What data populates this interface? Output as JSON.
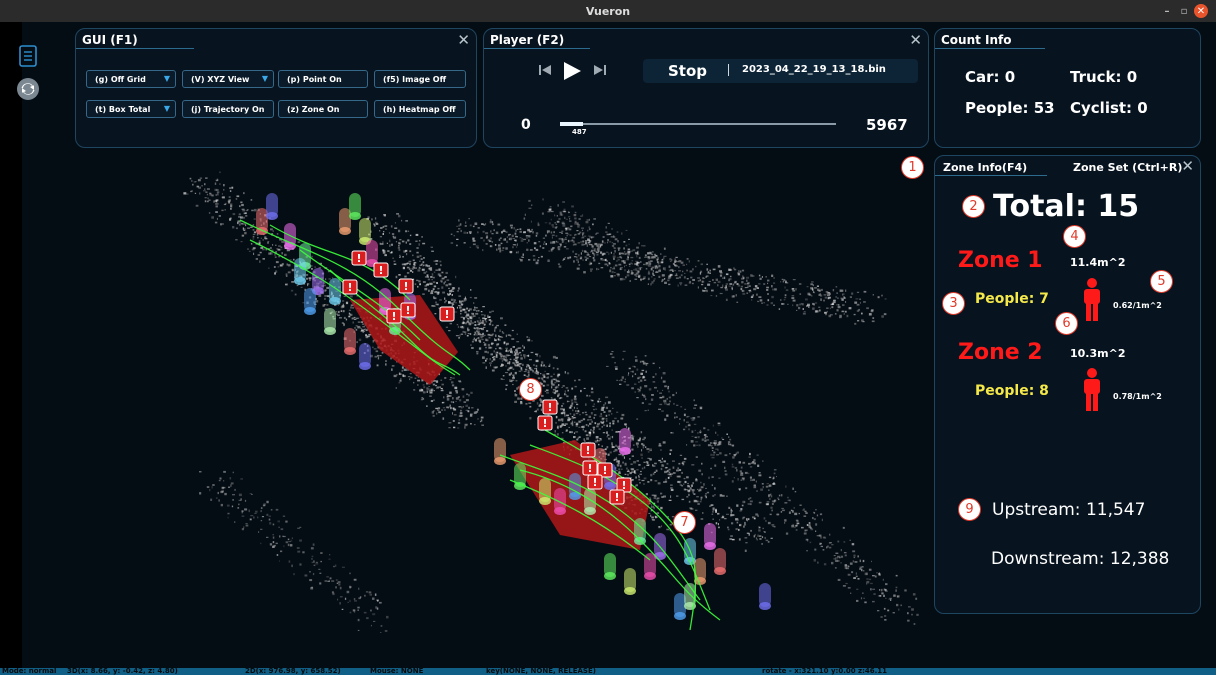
{
  "window": {
    "title": "Vueron",
    "min": "–",
    "max": "▫",
    "close": "✕"
  },
  "gui_panel": {
    "title": "GUI (F1)",
    "close": "✕",
    "buttons": [
      {
        "label": "(g) Off Grid",
        "dropdown": true
      },
      {
        "label": "(V) XYZ View",
        "dropdown": true
      },
      {
        "label": "(p) Point On",
        "dropdown": false
      },
      {
        "label": "(f5) Image Off",
        "dropdown": false
      },
      {
        "label": "(t) Box Total",
        "dropdown": true
      },
      {
        "label": "(j) Trajectory On",
        "dropdown": false
      },
      {
        "label": "(z) Zone On",
        "dropdown": false
      },
      {
        "label": "(h) Heatmap Off",
        "dropdown": false
      }
    ]
  },
  "player_panel": {
    "title": "Player (F2)",
    "close": "✕",
    "stop_label": "Stop",
    "filename": "2023_04_22_19_13_18.bin",
    "start": "0",
    "current": "487",
    "end": "5967",
    "progress_fraction": 0.0816
  },
  "count_panel": {
    "title": "Count Info",
    "car": "Car: 0",
    "truck": "Truck: 0",
    "people": "People: 53",
    "cyclist": "Cyclist: 0"
  },
  "zone_panel": {
    "title": "Zone Info(F4)",
    "zone_set": "Zone Set (Ctrl+R)",
    "close": "✕",
    "total": "Total: 15",
    "zones": [
      {
        "name": "Zone 1",
        "area": "11.4m^2",
        "people": "People: 7",
        "density": "0.62/1m^2"
      },
      {
        "name": "Zone 2",
        "area": "10.3m^2",
        "people": "People: 8",
        "density": "0.78/1m^2"
      }
    ],
    "upstream": "Upstream: 11,547",
    "downstream": "Downstream: 12,388"
  },
  "markers": [
    "1",
    "2",
    "3",
    "4",
    "5",
    "6",
    "7",
    "8",
    "9"
  ],
  "status": {
    "mode": "Mode: normal",
    "p3d": "3D(x: 8.66, y: -0.42, z: 4.80)",
    "p2d": "2D(x: 976.98, y: 658.52)",
    "mouse": "Mouse: NONE",
    "key": "key(NONE, NONE, RELEASE)",
    "rotate": "rotate - x:321.10 y:0.00 z:46.11"
  },
  "colors": {
    "accent": "#3aa8e8",
    "zone_red": "#ff1a1a",
    "people_yellow": "#f5e94a",
    "marker_red": "#e03a2a",
    "track_green": "#3cff3c",
    "status_blue": "#0f5f86"
  },
  "icons": [
    "document-icon",
    "refresh-icon",
    "play-icon",
    "skip-back-icon",
    "skip-forward-icon",
    "person-icon",
    "alert-icon"
  ]
}
